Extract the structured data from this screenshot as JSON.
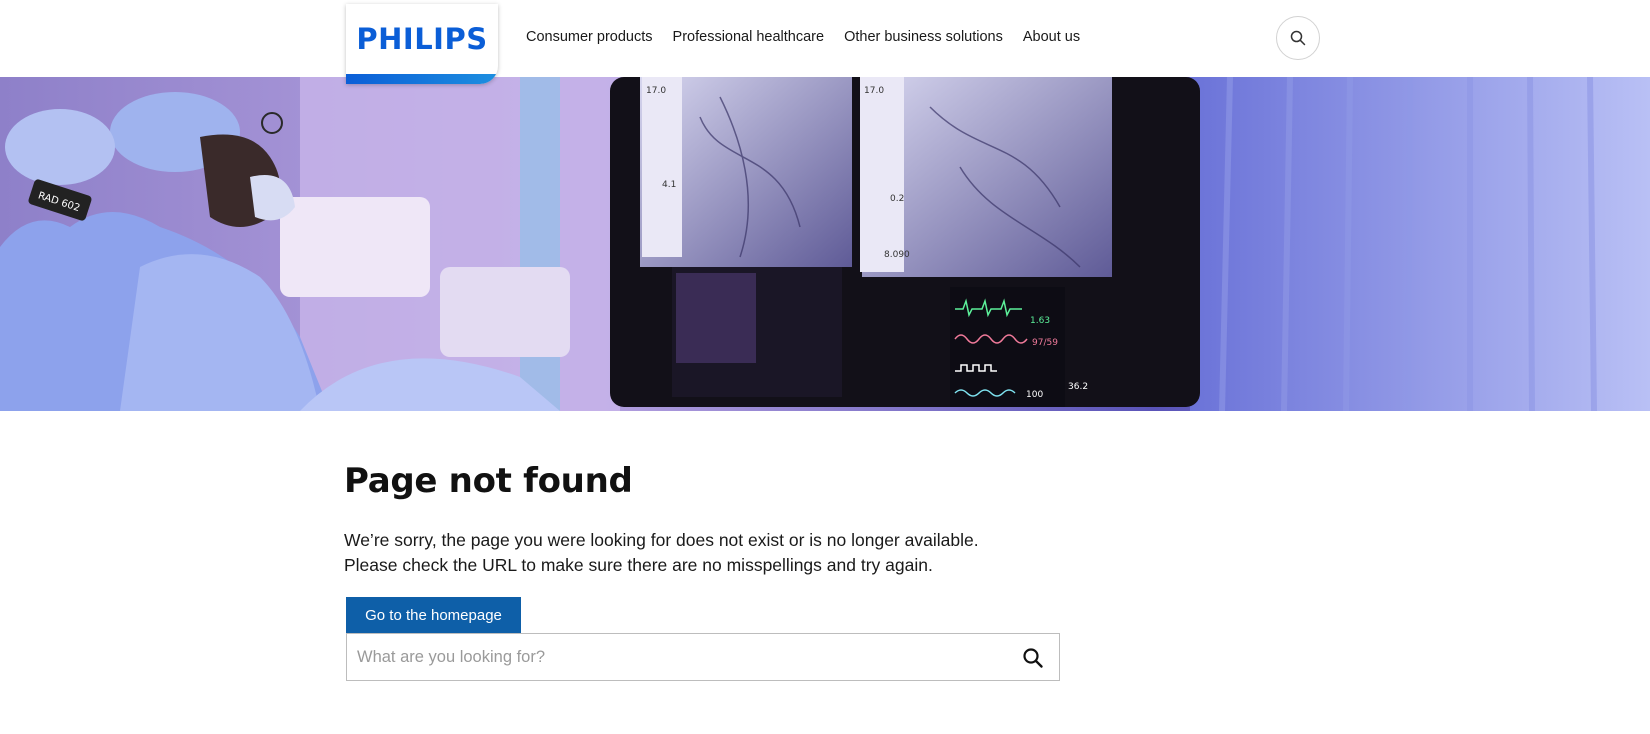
{
  "brand": {
    "name": "PHILIPS",
    "color": "#0b5ed7"
  },
  "nav": {
    "items": [
      {
        "label": "Consumer products"
      },
      {
        "label": "Professional healthcare"
      },
      {
        "label": "Other business solutions"
      },
      {
        "label": "About us"
      }
    ],
    "search_icon": "search-icon"
  },
  "hero": {
    "badge_text": "RAD 602",
    "monitor_readouts": [
      "17.0",
      "17.0",
      "0.2",
      "8.090",
      "1.63",
      "97/59",
      "100",
      "36.2",
      "4.1"
    ]
  },
  "main": {
    "title": "Page not found",
    "message_line1": "We’re sorry, the page you were looking for does not exist or is no longer available.",
    "message_line2": "Please check the URL to make sure there are no misspellings and try again.",
    "home_button_label": "Go to the homepage",
    "search_placeholder": "What are you looking for?",
    "search_icon": "search-icon",
    "accent_color": "#0e5fa8"
  }
}
